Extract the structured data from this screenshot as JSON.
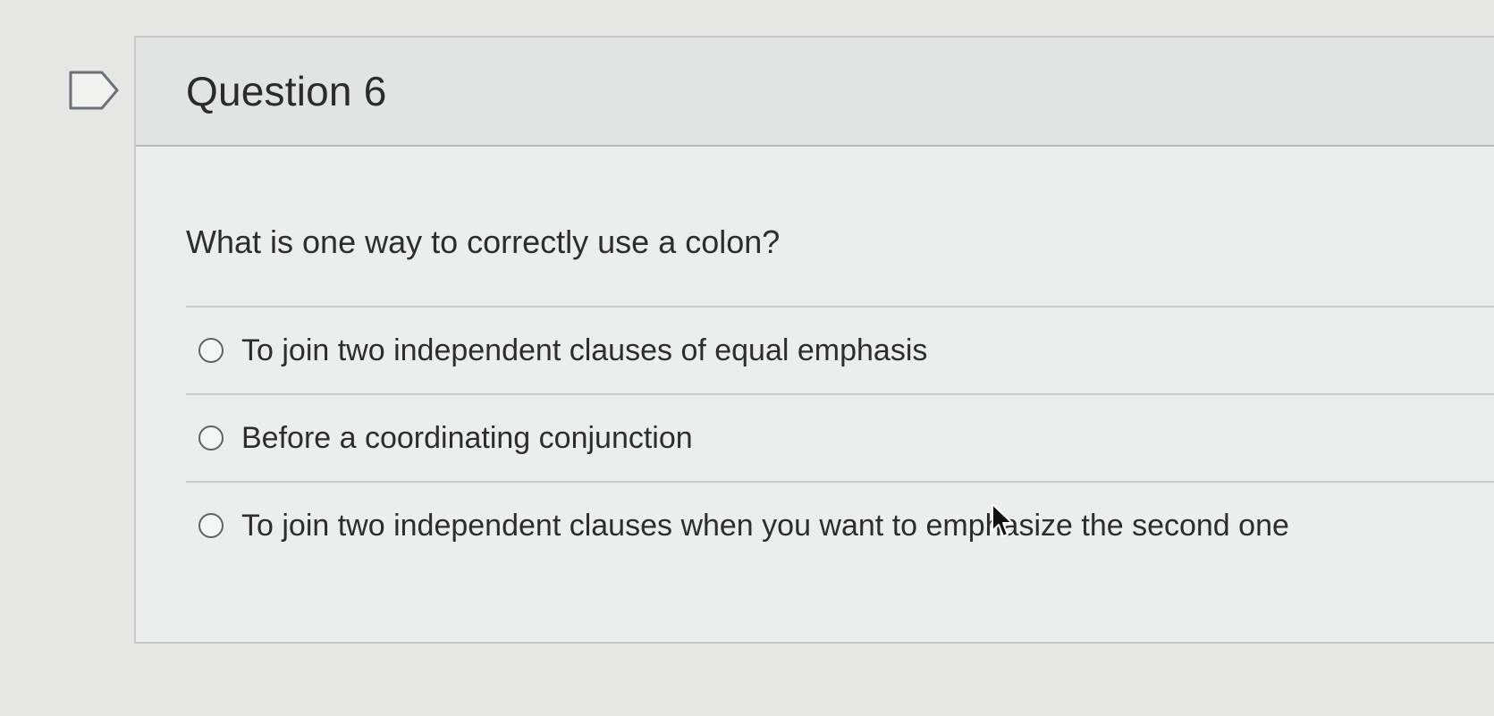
{
  "question": {
    "title": "Question 6",
    "text": "What is one way to correctly use a colon?",
    "flag_icon": "flag-question-icon",
    "answers": [
      {
        "label": "To join two independent clauses of equal emphasis",
        "selected": false
      },
      {
        "label": "Before a coordinating conjunction",
        "selected": false
      },
      {
        "label": "To join two independent clauses when you want to emphasize the second one",
        "selected": false
      }
    ]
  },
  "colors": {
    "page_background": "#e6e6e4",
    "header_background": "#e2e3e3",
    "text": "#2d2d2d"
  }
}
